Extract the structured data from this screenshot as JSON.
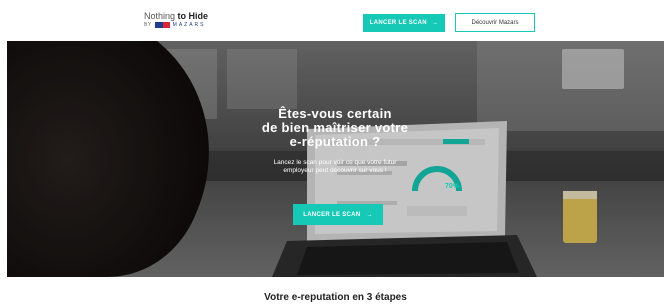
{
  "header": {
    "logo": {
      "part1": "Nothing",
      "part2": "to Hide",
      "by": "BY",
      "brand": "MAZARS"
    },
    "scan_button": {
      "label": "LANCER LE SCAN",
      "arrow": "→"
    },
    "mazars_button": {
      "label": "Découvrir Mazars"
    }
  },
  "hero": {
    "title_lines": [
      "Êtes-vous certain",
      "de bien maîtriser votre",
      "e-réputation ?"
    ],
    "subtitle_lines": [
      "Lancez le scan pour voir ce que votre futur",
      "employeur peut découvrir sur vous !"
    ],
    "scan_button": {
      "label": "LANCER LE SCAN",
      "arrow": "→"
    },
    "screen_values": {
      "percent": "70%"
    }
  },
  "section": {
    "title": "Votre e-reputation en 3 étapes"
  },
  "colors": {
    "accent": "#16c9b6",
    "brand_blue": "#1f3b8c",
    "brand_red": "#d9263a"
  }
}
